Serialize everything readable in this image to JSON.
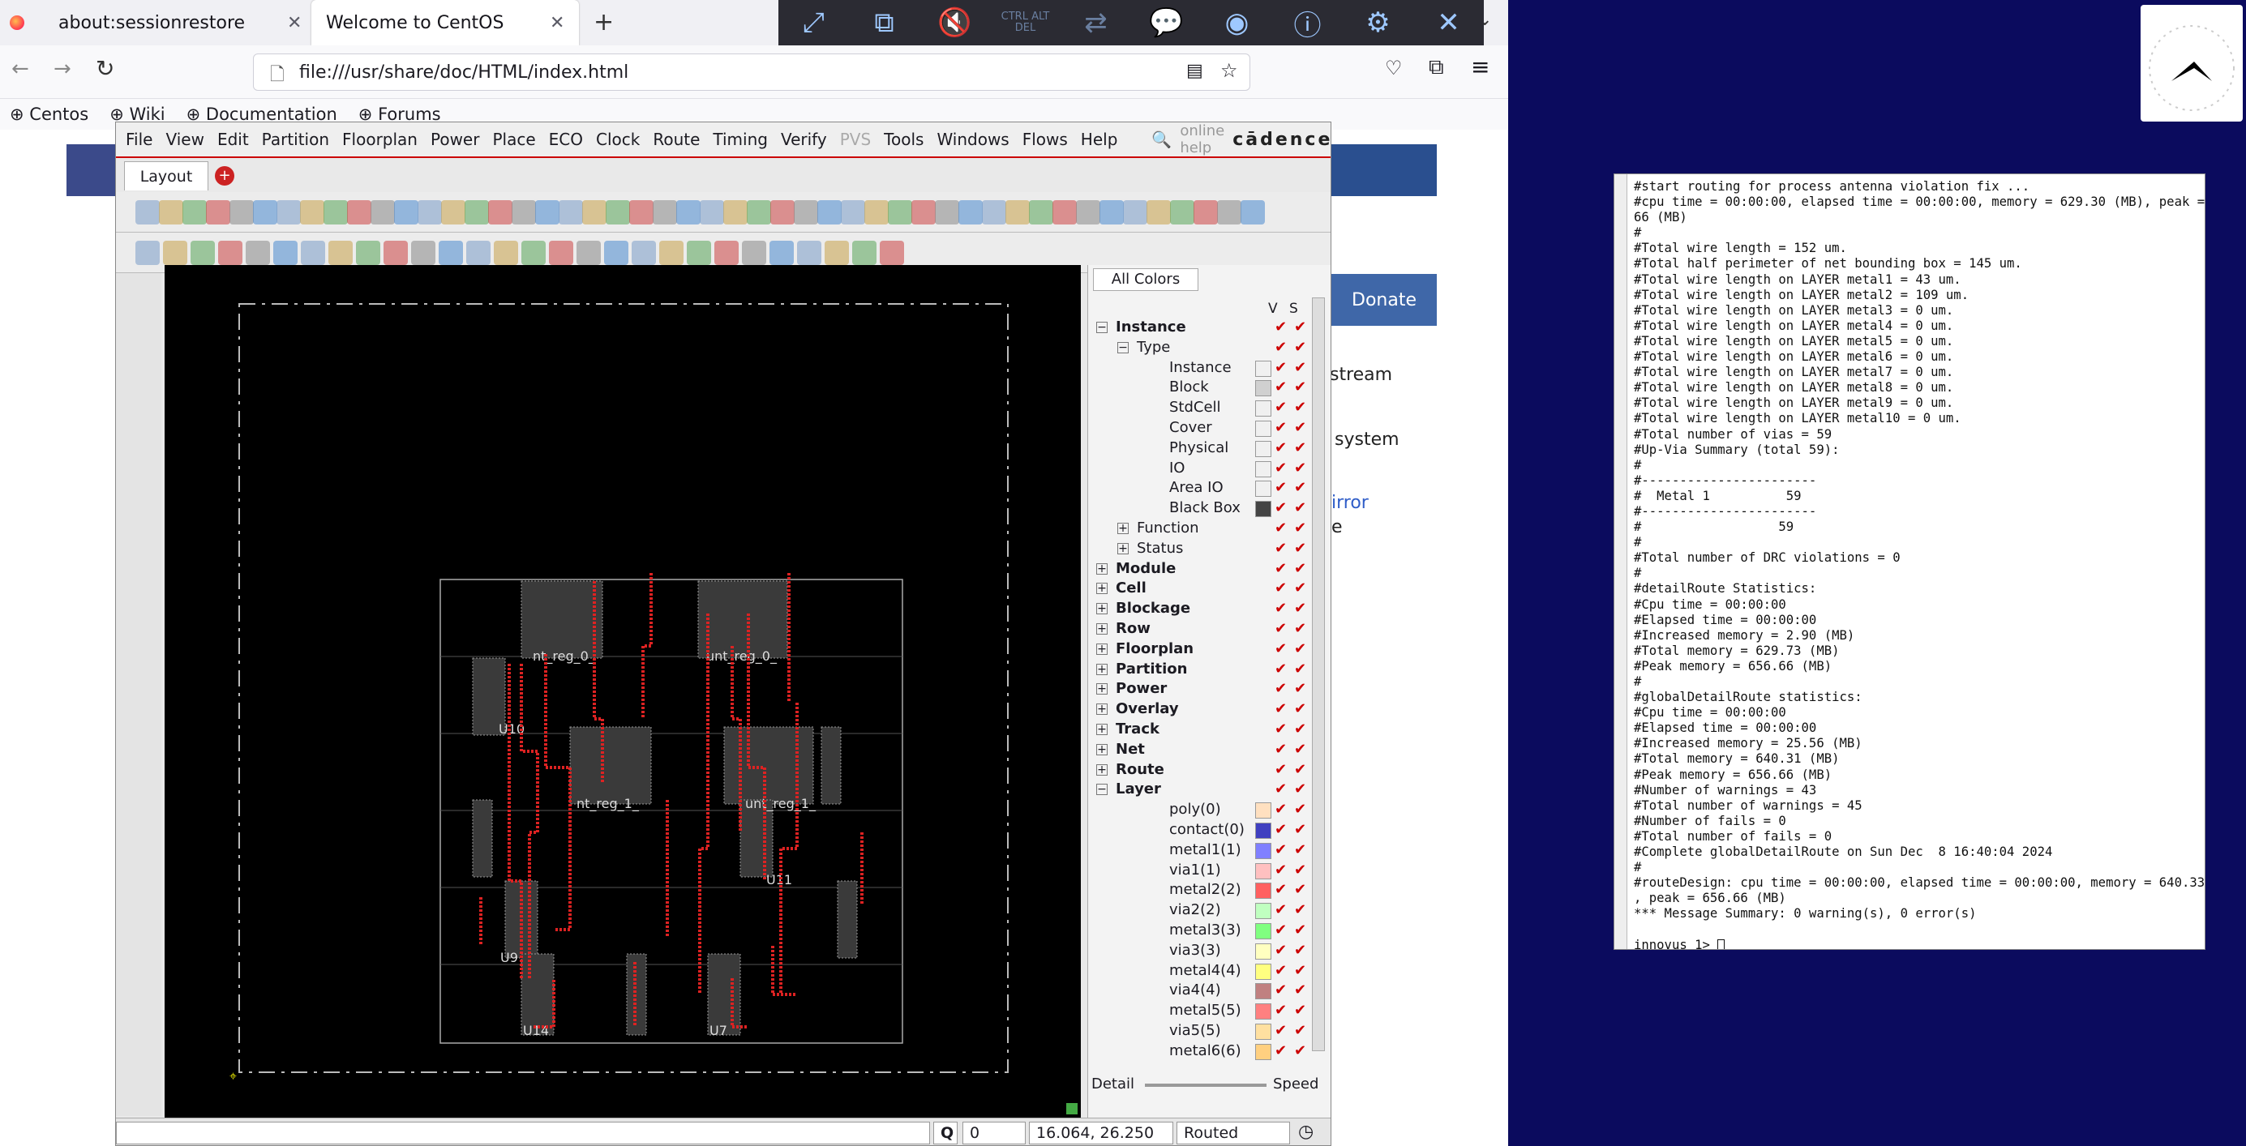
{
  "browser": {
    "tabs": [
      {
        "label": "about:sessionrestore"
      },
      {
        "label": "Welcome to CentOS"
      }
    ],
    "url": "file:///usr/share/doc/HTML/index.html",
    "bookmarks": [
      {
        "label": "Centos"
      },
      {
        "label": "Wiki"
      },
      {
        "label": "Documentation"
      },
      {
        "label": "Forums"
      }
    ],
    "vnc_buttons": [
      "fullscreen-icon",
      "scale-icon",
      "mute-icon",
      "ctrl-alt-del-icon",
      "clipboard-icon",
      "chat-icon",
      "record-icon",
      "info-icon",
      "gear-icon",
      "close-icon"
    ],
    "ctrl_alt_del_label": "CTRL ALT DEL"
  },
  "webpage": {
    "donate_label": "Donate",
    "fragments": [
      "stream",
      "system",
      "irror",
      "e"
    ]
  },
  "innovus": {
    "menu": [
      "File",
      "View",
      "Edit",
      "Partition",
      "Floorplan",
      "Power",
      "Place",
      "ECO",
      "Clock",
      "Route",
      "Timing",
      "Verify",
      "PVS",
      "Tools",
      "Windows",
      "Flows",
      "Help"
    ],
    "disabled_menu": "PVS",
    "search_placeholder": "online help",
    "brand": "cādence",
    "tab_label": "Layout",
    "panel": {
      "color_button": "All Colors",
      "col_v": "V",
      "col_s": "S",
      "rows": [
        {
          "label": "Instance",
          "level": 0,
          "bold": true,
          "expand": "−"
        },
        {
          "label": "Type",
          "level": 1,
          "expand": "−"
        },
        {
          "label": "Instance",
          "level": 2,
          "swatch": "#f0f0f0"
        },
        {
          "label": "Block",
          "level": 2,
          "swatch": "#d0d0d0"
        },
        {
          "label": "StdCell",
          "level": 2,
          "swatch": "#f0f0f0"
        },
        {
          "label": "Cover",
          "level": 2,
          "swatch": "#f0f0f0"
        },
        {
          "label": "Physical",
          "level": 2,
          "swatch": "#f0f0f0"
        },
        {
          "label": "IO",
          "level": 2,
          "swatch": "#f0f0f0"
        },
        {
          "label": "Area IO",
          "level": 2,
          "swatch": "#f0f0f0"
        },
        {
          "label": "Black Box",
          "level": 2,
          "swatch": "#444444"
        },
        {
          "label": "Function",
          "level": 1,
          "expand": "+"
        },
        {
          "label": "Status",
          "level": 1,
          "expand": "+"
        },
        {
          "label": "Module",
          "level": 0,
          "bold": true,
          "expand": "+"
        },
        {
          "label": "Cell",
          "level": 0,
          "bold": true,
          "expand": "+"
        },
        {
          "label": "Blockage",
          "level": 0,
          "bold": true,
          "expand": "+"
        },
        {
          "label": "Row",
          "level": 0,
          "bold": true,
          "expand": "+"
        },
        {
          "label": "Floorplan",
          "level": 0,
          "bold": true,
          "expand": "+"
        },
        {
          "label": "Partition",
          "level": 0,
          "bold": true,
          "expand": "+"
        },
        {
          "label": "Power",
          "level": 0,
          "bold": true,
          "expand": "+"
        },
        {
          "label": "Overlay",
          "level": 0,
          "bold": true,
          "expand": "+"
        },
        {
          "label": "Track",
          "level": 0,
          "bold": true,
          "expand": "+"
        },
        {
          "label": "Net",
          "level": 0,
          "bold": true,
          "expand": "+"
        },
        {
          "label": "Route",
          "level": 0,
          "bold": true,
          "expand": "+"
        },
        {
          "label": "Layer",
          "level": 0,
          "bold": true,
          "expand": "−"
        },
        {
          "label": "poly(0)",
          "level": 2,
          "swatch": "#ffe0c0"
        },
        {
          "label": "contact(0)",
          "level": 2,
          "swatch": "#4040c0"
        },
        {
          "label": "metal1(1)",
          "level": 2,
          "swatch": "#8080ff"
        },
        {
          "label": "via1(1)",
          "level": 2,
          "swatch": "#ffc0c0"
        },
        {
          "label": "metal2(2)",
          "level": 2,
          "swatch": "#ff6060"
        },
        {
          "label": "via2(2)",
          "level": 2,
          "swatch": "#c0ffc0"
        },
        {
          "label": "metal3(3)",
          "level": 2,
          "swatch": "#80ff80"
        },
        {
          "label": "via3(3)",
          "level": 2,
          "swatch": "#ffffc0"
        },
        {
          "label": "metal4(4)",
          "level": 2,
          "swatch": "#ffff80"
        },
        {
          "label": "via4(4)",
          "level": 2,
          "swatch": "#c08080"
        },
        {
          "label": "metal5(5)",
          "level": 2,
          "swatch": "#ff8080"
        },
        {
          "label": "via5(5)",
          "level": 2,
          "swatch": "#ffe0a0"
        },
        {
          "label": "metal6(6)",
          "level": 2,
          "swatch": "#ffd080"
        }
      ],
      "detail_label": "Detail",
      "speed_label": "Speed"
    },
    "cell_labels": [
      "nt_reg_0_",
      "unt_reg_0_",
      "U10",
      "nt_reg_1_",
      "unt_reg_1_",
      "U11",
      "U9",
      "U14",
      "U7"
    ],
    "status": {
      "query": "Q",
      "count": "0",
      "coords": "16.064, 26.250",
      "state": "Routed"
    }
  },
  "terminal": {
    "lines": [
      "#start routing for process antenna violation fix ...",
      "#cpu time = 00:00:00, elapsed time = 00:00:00, memory = 629.30 (MB), peak = 656.",
      "66 (MB)",
      "#",
      "#Total wire length = 152 um.",
      "#Total half perimeter of net bounding box = 145 um.",
      "#Total wire length on LAYER metal1 = 43 um.",
      "#Total wire length on LAYER metal2 = 109 um.",
      "#Total wire length on LAYER metal3 = 0 um.",
      "#Total wire length on LAYER metal4 = 0 um.",
      "#Total wire length on LAYER metal5 = 0 um.",
      "#Total wire length on LAYER metal6 = 0 um.",
      "#Total wire length on LAYER metal7 = 0 um.",
      "#Total wire length on LAYER metal8 = 0 um.",
      "#Total wire length on LAYER metal9 = 0 um.",
      "#Total wire length on LAYER metal10 = 0 um.",
      "#Total number of vias = 59",
      "#Up-Via Summary (total 59):",
      "#",
      "#-----------------------",
      "#  Metal 1          59",
      "#-----------------------",
      "#                  59",
      "#",
      "#Total number of DRC violations = 0",
      "#",
      "#detailRoute Statistics:",
      "#Cpu time = 00:00:00",
      "#Elapsed time = 00:00:00",
      "#Increased memory = 2.90 (MB)",
      "#Total memory = 629.73 (MB)",
      "#Peak memory = 656.66 (MB)",
      "#",
      "#globalDetailRoute statistics:",
      "#Cpu time = 00:00:00",
      "#Elapsed time = 00:00:00",
      "#Increased memory = 25.56 (MB)",
      "#Total memory = 640.31 (MB)",
      "#Peak memory = 656.66 (MB)",
      "#Number of warnings = 43",
      "#Total number of warnings = 45",
      "#Number of fails = 0",
      "#Total number of fails = 0",
      "#Complete globalDetailRoute on Sun Dec  8 16:40:04 2024",
      "#",
      "#routeDesign: cpu time = 00:00:00, elapsed time = 00:00:00, memory = 640.33 (MB)",
      ", peak = 656.66 (MB)",
      "*** Message Summary: 0 warning(s), 0 error(s)",
      "",
      "innovus 1> "
    ]
  }
}
